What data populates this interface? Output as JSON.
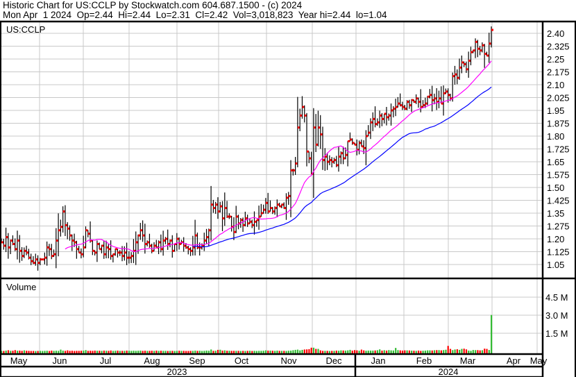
{
  "header": {
    "line1": "Historic Chart for US:CCLP by Stockwatch.com 604.687.1500 - (c) 2024",
    "line2": "Mon Apr  1 2024  Op=2.44  Hi=2.44  Lo=2.31  Cl=2.42  Vol=3,018,823  Year hi=2.44  lo=1.04"
  },
  "chart_data": {
    "type": "bar",
    "subtype": "ohlc",
    "symbol": "US:CCLP",
    "price_axis": {
      "ticks": [
        "2.40",
        "2.325",
        "2.25",
        "2.175",
        "2.10",
        "2.025",
        "1.95",
        "1.875",
        "1.80",
        "1.725",
        "1.65",
        "1.575",
        "1.50",
        "1.425",
        "1.35",
        "1.275",
        "1.20",
        "1.125",
        "1.05"
      ],
      "ylim": [
        1.02,
        2.47
      ]
    },
    "volume_axis": {
      "label": "Volume",
      "ticks": [
        "4.5 M",
        "3.0 M",
        "1.5 M"
      ],
      "ylim_millions": [
        0,
        5.8
      ]
    },
    "x_months": [
      "May",
      "Jun",
      "Jul",
      "Aug",
      "Sep",
      "Oct",
      "Nov",
      "Dec",
      "Jan",
      "Feb",
      "Mar",
      "Apr",
      "May"
    ],
    "x_years": [
      "2023",
      "2024"
    ],
    "moving_averages": [
      {
        "name": "MA20",
        "color": "#ff00ff",
        "period": 20
      },
      {
        "name": "MA50",
        "color": "#0000ff",
        "period": 50
      }
    ],
    "colors": {
      "bar": "#000000",
      "close_tick": "#ff0000",
      "vol_up": "#33bb33",
      "vol_down": "#ff0000",
      "grid": "#c8c8c8"
    },
    "closes": [
      1.18,
      1.16,
      1.21,
      1.15,
      1.19,
      1.17,
      1.14,
      1.19,
      1.13,
      1.1,
      1.13,
      1.12,
      1.09,
      1.07,
      1.06,
      1.08,
      1.06,
      1.08,
      1.08,
      1.09,
      1.15,
      1.14,
      1.1,
      1.11,
      1.19,
      1.25,
      1.27,
      1.36,
      1.28,
      1.26,
      1.22,
      1.19,
      1.18,
      1.14,
      1.12,
      1.11,
      1.15,
      1.25,
      1.23,
      1.19,
      1.13,
      1.12,
      1.17,
      1.14,
      1.16,
      1.11,
      1.15,
      1.14,
      1.1,
      1.11,
      1.14,
      1.12,
      1.12,
      1.1,
      1.12,
      1.09,
      1.09,
      1.1,
      1.13,
      1.18,
      1.22,
      1.25,
      1.22,
      1.17,
      1.18,
      1.16,
      1.13,
      1.16,
      1.15,
      1.18,
      1.14,
      1.19,
      1.2,
      1.17,
      1.19,
      1.13,
      1.17,
      1.2,
      1.17,
      1.18,
      1.16,
      1.15,
      1.14,
      1.13,
      1.15,
      1.22,
      1.15,
      1.15,
      1.16,
      1.19,
      1.21,
      1.25,
      1.4,
      1.38,
      1.4,
      1.36,
      1.39,
      1.32,
      1.38,
      1.33,
      1.33,
      1.27,
      1.24,
      1.33,
      1.29,
      1.31,
      1.28,
      1.32,
      1.29,
      1.3,
      1.28,
      1.3,
      1.31,
      1.33,
      1.35,
      1.37,
      1.41,
      1.36,
      1.38,
      1.36,
      1.38,
      1.4,
      1.39,
      1.4,
      1.38,
      1.44,
      1.45,
      1.6,
      1.6,
      1.64,
      1.85,
      1.92,
      1.97,
      1.92,
      1.71,
      1.67,
      1.58,
      1.85,
      1.75,
      1.85,
      1.81,
      1.66,
      1.68,
      1.65,
      1.66,
      1.65,
      1.66,
      1.63,
      1.68,
      1.7,
      1.67,
      1.69,
      1.77,
      1.78,
      1.76,
      1.75,
      1.72,
      1.76,
      1.74,
      1.73,
      1.8,
      1.82,
      1.88,
      1.9,
      1.87,
      1.88,
      1.92,
      1.9,
      1.93,
      1.91,
      1.92,
      1.95,
      1.96,
      1.97,
      1.99,
      1.98,
      1.97,
      1.96,
      2.0,
      1.98,
      2.01,
      2.0,
      2.02,
      2.0,
      1.97,
      1.98,
      1.99,
      2.03,
      2.04,
      2.01,
      2.02,
      2.0,
      2.02,
      1.99,
      2.05,
      2.06,
      2.04,
      2.02,
      2.15,
      2.16,
      2.14,
      2.2,
      2.23,
      2.22,
      2.19,
      2.24,
      2.29,
      2.3,
      2.35,
      2.31,
      2.3,
      2.33,
      2.28,
      2.27,
      2.34,
      2.42
    ],
    "volumes_thousands": [
      40,
      30,
      60,
      90,
      40,
      50,
      100,
      50,
      60,
      40,
      80,
      50,
      40,
      30,
      30,
      20,
      30,
      40,
      30,
      40,
      50,
      30,
      60,
      40,
      50,
      40,
      140,
      60,
      40,
      80,
      40,
      50,
      30,
      40,
      40,
      50,
      60,
      100,
      40,
      50,
      40,
      60,
      50,
      50,
      40,
      60,
      50,
      40,
      70,
      40,
      50,
      60,
      40,
      40,
      40,
      60,
      50,
      40,
      50,
      40,
      50,
      60,
      40,
      50,
      40,
      40,
      50,
      40,
      60,
      40,
      50,
      40,
      40,
      30,
      40,
      40,
      30,
      40,
      50,
      40,
      40,
      30,
      30,
      40,
      40,
      60,
      40,
      50,
      30,
      40,
      60,
      50,
      150,
      40,
      50,
      120,
      130,
      60,
      80,
      50,
      50,
      40,
      40,
      40,
      40,
      30,
      40,
      30,
      40,
      50,
      30,
      40,
      30,
      40,
      40,
      50,
      80,
      60,
      60,
      50,
      40,
      60,
      40,
      40,
      40,
      30,
      50,
      60,
      90,
      120,
      140,
      80,
      120,
      150,
      160,
      180,
      300,
      300,
      200,
      200,
      80,
      40,
      40,
      40,
      30,
      40,
      40,
      60,
      50,
      80,
      70,
      60,
      80,
      120,
      60,
      100,
      80,
      50,
      140,
      80,
      50,
      60,
      60,
      60,
      70,
      90,
      160,
      60,
      90,
      60,
      100,
      80,
      70,
      280,
      100,
      80,
      60,
      80,
      80,
      70,
      60,
      50,
      40,
      60,
      40,
      50,
      60,
      80,
      80,
      70,
      90,
      100,
      100,
      80,
      100,
      130,
      450,
      200,
      100,
      150,
      170,
      120,
      200,
      220,
      160,
      60,
      40,
      110,
      100,
      100,
      80,
      90,
      220,
      200,
      110,
      3019
    ]
  }
}
